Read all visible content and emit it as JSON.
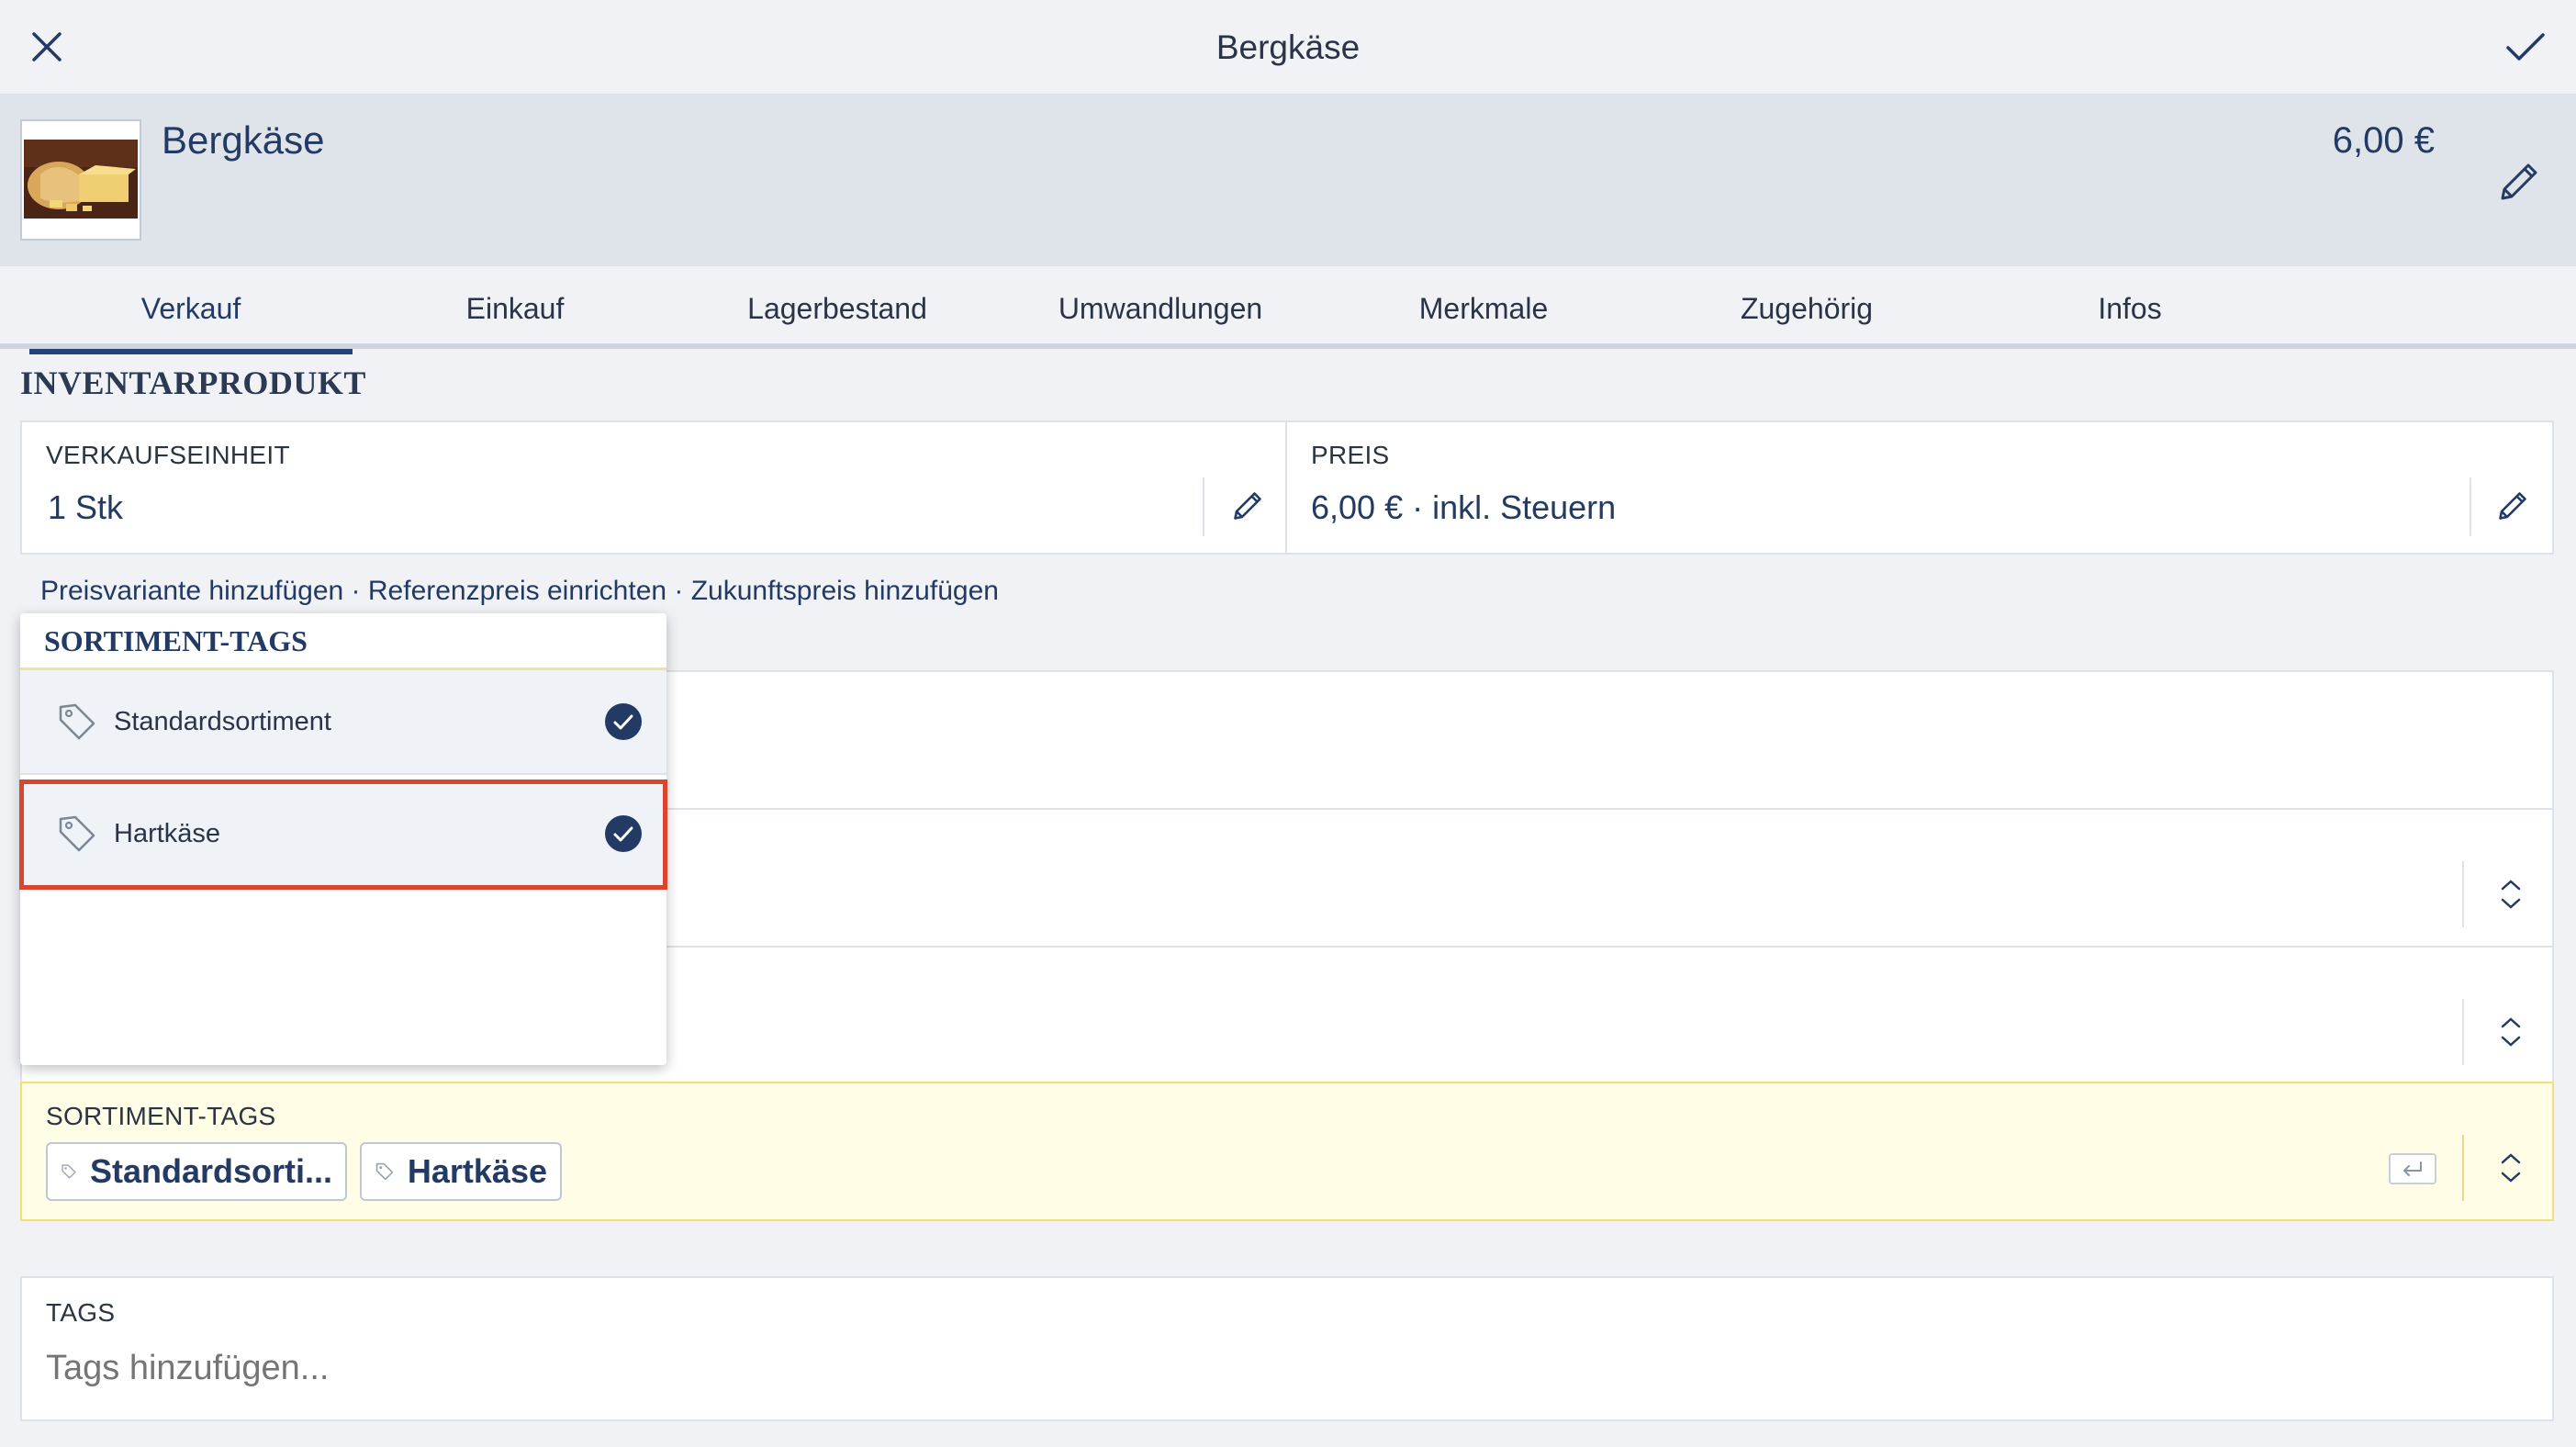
{
  "topbar": {
    "title": "Bergkäse"
  },
  "product": {
    "name": "Bergkäse",
    "price": "6,00 €"
  },
  "tabs": [
    {
      "label": "Verkauf",
      "active": true
    },
    {
      "label": "Einkauf"
    },
    {
      "label": "Lagerbestand"
    },
    {
      "label": "Umwandlungen"
    },
    {
      "label": "Merkmale"
    },
    {
      "label": "Zugehörig"
    },
    {
      "label": "Infos"
    }
  ],
  "section": {
    "title": "INVENTARPRODUKT"
  },
  "unit": {
    "label": "VERKAUFSEINHEIT",
    "value": "1 Stk"
  },
  "price": {
    "label": "PREIS",
    "value": "6,00 € · inkl. Steuern"
  },
  "links": {
    "price_variant": "Preisvariante hinzufügen",
    "reference_price": "Referenzpreis einrichten",
    "future_price": "Zukunftspreis hinzufügen",
    "separator": " · "
  },
  "sortiment_tags": {
    "label": "SORTIMENT-TAGS",
    "chips": [
      "Standardsorti...",
      "Hartkäse"
    ]
  },
  "tags": {
    "label": "TAGS",
    "placeholder": "Tags hinzufügen..."
  },
  "dropdown": {
    "header": "SORTIMENT-TAGS",
    "options": [
      {
        "label": "Standardsortiment",
        "checked": true
      },
      {
        "label": "Hartkäse",
        "checked": true
      }
    ]
  },
  "colors": {
    "accent": "#23437a",
    "highlight_border": "#d9462f",
    "focused_field_bg": "#fffde6",
    "focused_field_border": "#f2df7a"
  }
}
